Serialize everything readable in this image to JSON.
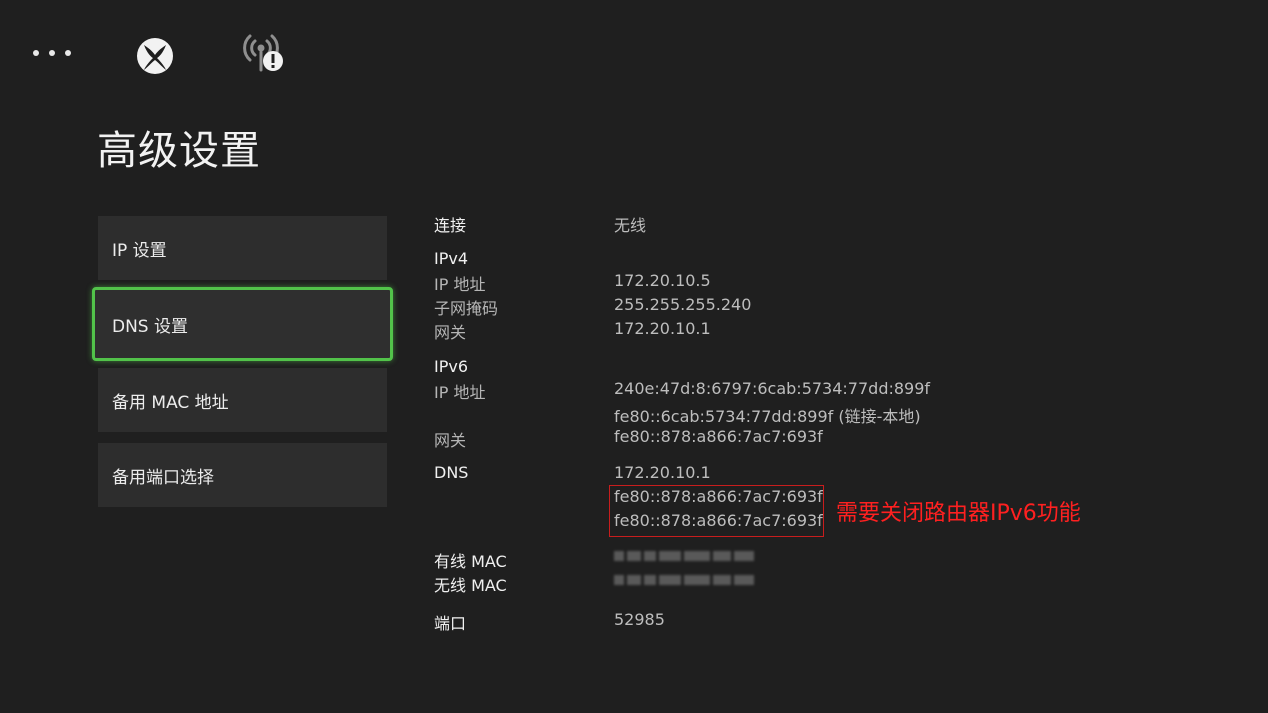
{
  "topbar": {
    "icons": [
      "more-icon",
      "xbox-icon",
      "network-warning-icon"
    ]
  },
  "page": {
    "title": "高级设置"
  },
  "menu": {
    "items": [
      {
        "label": "IP 设置"
      },
      {
        "label": "DNS 设置"
      },
      {
        "label": "备用 MAC 地址"
      },
      {
        "label": "备用端口选择"
      }
    ],
    "selected_index": 1
  },
  "info": {
    "connection_label": "连接",
    "connection_value": "无线",
    "ipv4": {
      "heading": "IPv4",
      "ip_label": "IP 地址",
      "ip_value": "172.20.10.5",
      "subnet_label": "子网掩码",
      "subnet_value": "255.255.255.240",
      "gateway_label": "网关",
      "gateway_value": "172.20.10.1"
    },
    "ipv6": {
      "heading": "IPv6",
      "ip_label": "IP 地址",
      "ip_value_1": "240e:47d:8:6797:6cab:5734:77dd:899f",
      "ip_value_2": "fe80::6cab:5734:77dd:899f (链接-本地)",
      "gateway_label": "网关",
      "gateway_value": "fe80::878:a866:7ac7:693f"
    },
    "dns": {
      "label": "DNS",
      "value_1": "172.20.10.1",
      "value_2": "fe80::878:a866:7ac7:693f",
      "value_3": "fe80::878:a866:7ac7:693f"
    },
    "wired_mac_label": "有线 MAC",
    "wireless_mac_label": "无线 MAC",
    "port_label": "端口",
    "port_value": "52985"
  },
  "annotation": {
    "text": "需要关闭路由器IPv6功能",
    "color": "#ff2020"
  },
  "colors": {
    "background": "#1f1f1f",
    "selected_border": "#52c34a",
    "annotation_box": "#c81d1d"
  }
}
